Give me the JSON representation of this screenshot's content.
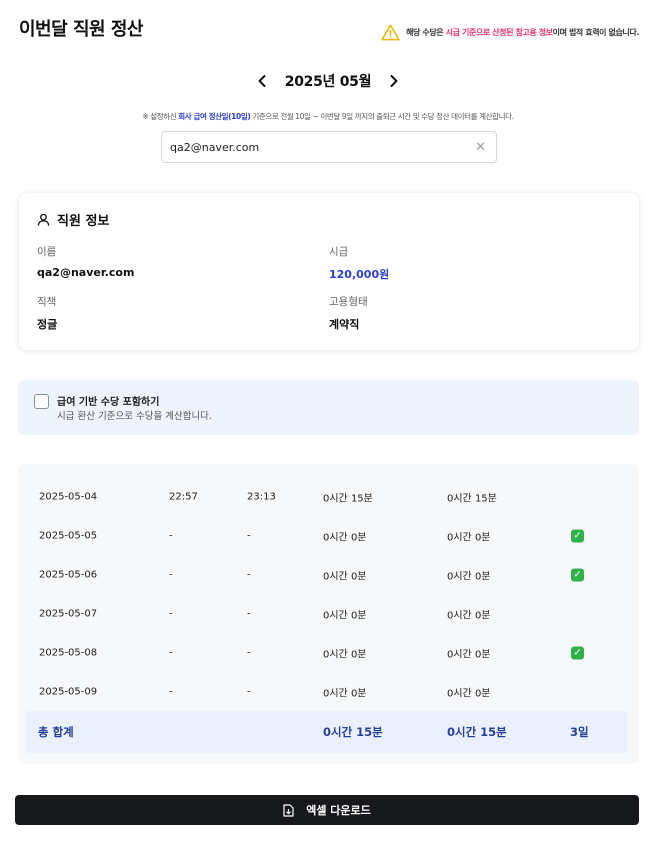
{
  "header": {
    "title": "이번달 직원 정산",
    "notice_prefix": "해당 수당은 ",
    "notice_highlight": "시급 기준으로 산정된 참고용 정보",
    "notice_suffix": "이며 법적 효력이 없습니다."
  },
  "month_nav": {
    "label": "2025년 05월",
    "prev_icon": "chevron-left-icon",
    "next_icon": "chevron-right-icon"
  },
  "description": {
    "prefix": "※ 설정하신 ",
    "highlight": "회사 급여 정산일(10일)",
    "suffix": " 기준으로 전월 10일 ~ 이번달 9일 까지의 출퇴근 시간 및 수당 정산 데이터를 계산합니다."
  },
  "search": {
    "value": "qa2@naver.com",
    "clear_icon": "close-icon"
  },
  "employee_info": {
    "heading": "직원 정보",
    "name_label": "이름",
    "name_value": "qa2@naver.com",
    "wage_label": "시급",
    "wage_value": "120,000원",
    "position_label": "직책",
    "position_value": "정글",
    "employment_label": "고용형태",
    "employment_value": "계약직"
  },
  "option": {
    "checked": false,
    "title": "급여 기반 수당 포함하기",
    "subtitle": "시급 환산 기준으로 수당을 계산합니다."
  },
  "rows": [
    {
      "date": "2025-05-04",
      "in": "22:57",
      "out": "23:13",
      "worked": "0시간 15분",
      "paid": "0시간 15분",
      "ok": false
    },
    {
      "date": "2025-05-05",
      "in": "-",
      "out": "-",
      "worked": "0시간 0분",
      "paid": "0시간 0분",
      "ok": true
    },
    {
      "date": "2025-05-06",
      "in": "-",
      "out": "-",
      "worked": "0시간 0분",
      "paid": "0시간 0분",
      "ok": true
    },
    {
      "date": "2025-05-07",
      "in": "-",
      "out": "-",
      "worked": "0시간 0분",
      "paid": "0시간 0분",
      "ok": false
    },
    {
      "date": "2025-05-08",
      "in": "-",
      "out": "-",
      "worked": "0시간 0분",
      "paid": "0시간 0분",
      "ok": true
    },
    {
      "date": "2025-05-09",
      "in": "-",
      "out": "-",
      "worked": "0시간 0분",
      "paid": "0시간 0분",
      "ok": false
    }
  ],
  "total": {
    "label": "총 합계",
    "worked": "0시간 15분",
    "paid": "0시간 15분",
    "days": "3일"
  },
  "download": {
    "label": "엑셀 다운로드",
    "icon": "file-download-icon"
  },
  "colors": {
    "accent": "#2c3ecc",
    "warning": "#e8336b",
    "check": "#2fb14a",
    "button": "#17181b"
  }
}
